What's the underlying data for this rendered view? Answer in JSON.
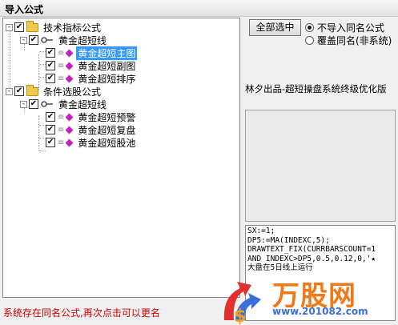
{
  "window": {
    "title": "导入公式"
  },
  "tree": [
    {
      "label": "技术指标公式",
      "checked": true,
      "expand": "-",
      "kind": "folder"
    },
    {
      "label": "黄金超短线",
      "checked": true,
      "expand": "-",
      "kind": "key"
    },
    {
      "label": "黄金超短主图",
      "checked": true,
      "kind": "leaf",
      "selected": true
    },
    {
      "label": "黄金超短副图",
      "checked": true,
      "kind": "leaf"
    },
    {
      "label": "黄金超短排序",
      "checked": true,
      "kind": "leaf"
    },
    {
      "label": "条件选股公式",
      "checked": true,
      "expand": "-",
      "kind": "folder"
    },
    {
      "label": "黄金超短线",
      "checked": true,
      "expand": "-",
      "kind": "key"
    },
    {
      "label": "黄金超短预警",
      "checked": true,
      "kind": "leaf"
    },
    {
      "label": "黄金超短复盘",
      "checked": true,
      "kind": "leaf"
    },
    {
      "label": "黄金超短股池",
      "checked": true,
      "kind": "leaf"
    }
  ],
  "select_all_label": "全部选中",
  "radio_skip": "不导入同名公式",
  "radio_overwrite": "覆盖同名(非系统)",
  "banner": "林夕出品-超短操盘系统终级优化版",
  "code_lines": [
    "SX:=1;",
    "DP5:=MA(INDEXC,5);",
    "DRAWTEXT_FIX(CURRBARSCOUNT=1",
    "AND INDEXC>DP5,0.5,0.12,0,'★",
    "大盘在5日线上运行"
  ],
  "status": "系统存在同名公式,再次点击可以更名",
  "watermark": {
    "text": "万股网",
    "url": "www.201082.com"
  },
  "colors": {
    "selection": "#3399ff",
    "status": "#cc0000"
  }
}
